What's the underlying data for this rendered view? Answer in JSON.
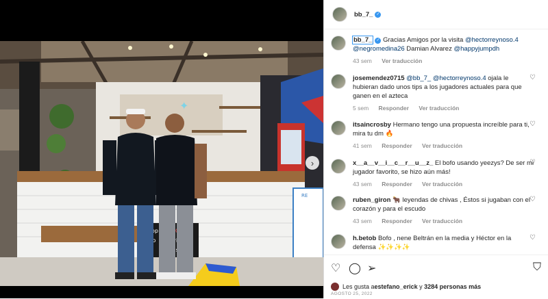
{
  "post": {
    "username": "bb_7_",
    "caption": {
      "username": "bb_7_",
      "text_before": "Gracias Amigos por la visita ",
      "mention1": "@hectorreynoso.4",
      "mention2": "@negromedina26",
      "mid_text": " Damian Alvarez ",
      "mention3": "@happyjumpdh",
      "time": "43 sem",
      "see_translation": "Ver traducción"
    },
    "comments": [
      {
        "username": "josemendez0715",
        "mention": "@bb_7_ @hectorreynoso.4",
        "text": " ojala le hubieran dado unos tips a los jugadores actuales para que ganen en el azteca",
        "time": "5 sem",
        "reply": "Responder",
        "translate": "Ver traducción"
      },
      {
        "username": "itsaincrosby",
        "mention": "",
        "text": " Hermano tengo una propuesta increíble para ti, mira tu dm 🔥",
        "time": "41 sem",
        "reply": "Responder",
        "translate": "Ver traducción"
      },
      {
        "username": "x__a__v__i__c__r__u__z_",
        "mention": "",
        "text": " El bofo usando yeezys? De ser mi jugador favorito, se hizo aún más!",
        "time": "43 sem",
        "reply": "Responder",
        "translate": "Ver traducción"
      },
      {
        "username": "ruben_giron",
        "mention": "",
        "text": " 🐂 leyendas de chivas , Éstos si jugaban con el corazón y para el escudo",
        "time": "43 sem",
        "reply": "Responder",
        "translate": "Ver traducción"
      },
      {
        "username": "h.betob",
        "mention": "",
        "text": " Bofo , nene Beltrán en la media y Héctor en la defensa ✨✨✨✨",
        "time": "",
        "reply": "",
        "translate": ""
      }
    ],
    "likes": {
      "prefix": "Les gusta a ",
      "user": "estefano_erick",
      "middle": " y ",
      "count": "3284 personas más"
    },
    "date": "AGOSTO 25, 2022",
    "icons": {
      "like": "heart-icon",
      "comment": "comment-icon",
      "share": "share-icon",
      "save": "bookmark-icon"
    },
    "photo_signs": {
      "board_line1": "Happ",
      "board_line2": "NO",
      "board_line3": "de o",
      "board_line4": "olvida",
      "board_line5": "cias",
      "menu_title": "RE"
    },
    "colors": {
      "accent": "#3897f0",
      "mention": "#00376b",
      "muted": "#8e8e8e"
    }
  }
}
